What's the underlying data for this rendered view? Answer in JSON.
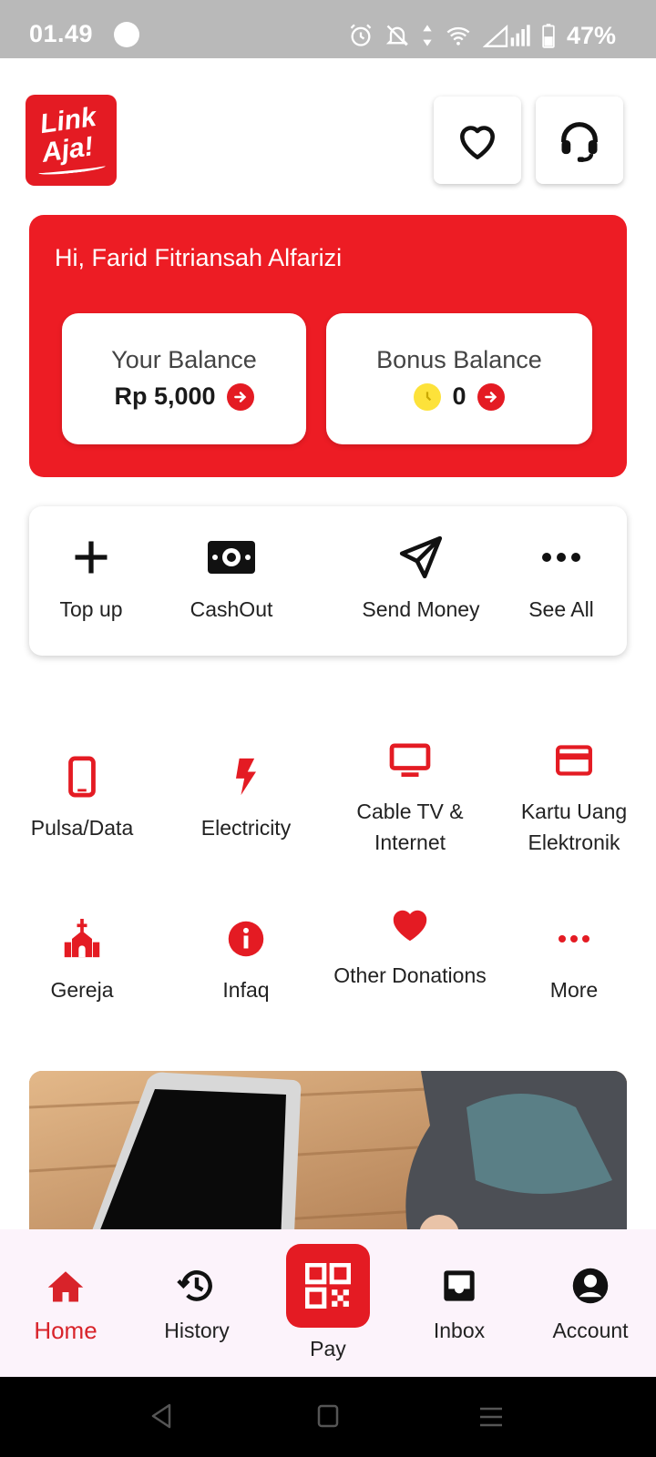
{
  "status_bar": {
    "time": "01.49",
    "battery": "47%"
  },
  "header": {
    "logo_text_line1": "Link",
    "logo_text_line2": "Aja!",
    "favorite_icon": "heart-icon",
    "support_icon": "headset-icon"
  },
  "greeting": {
    "text": "Hi, Farid Fitriansah Alfarizi",
    "your_balance_label": "Your Balance",
    "your_balance_value": "Rp 5,000",
    "bonus_balance_label": "Bonus Balance",
    "bonus_balance_value": "0"
  },
  "quick_actions": [
    {
      "label": "Top up",
      "icon": "plus-icon"
    },
    {
      "label": "CashOut",
      "icon": "cash-icon"
    },
    {
      "label": "Send Money",
      "icon": "send-icon"
    },
    {
      "label": "See All",
      "icon": "more-horizontal-icon"
    }
  ],
  "services": [
    {
      "label": "Pulsa/Data",
      "icon": "phone-icon"
    },
    {
      "label": "Electricity",
      "icon": "lightning-icon"
    },
    {
      "label": "Cable TV & Internet",
      "icon": "tv-icon"
    },
    {
      "label": "Kartu Uang Elektronik",
      "icon": "card-icon"
    },
    {
      "label": "Gereja",
      "icon": "church-icon"
    },
    {
      "label": "Infaq",
      "icon": "info-icon"
    },
    {
      "label": "Other Donations",
      "icon": "heart-icon"
    },
    {
      "label": "More",
      "icon": "more-horizontal-icon"
    }
  ],
  "bottom_nav": {
    "home": "Home",
    "history": "History",
    "pay": "Pay",
    "inbox": "Inbox",
    "account": "Account"
  },
  "colors": {
    "brand_red": "#e41b23",
    "card_red": "#ed1c24",
    "coin_yellow": "#fde23a",
    "nav_background": "#fcf3fb"
  }
}
